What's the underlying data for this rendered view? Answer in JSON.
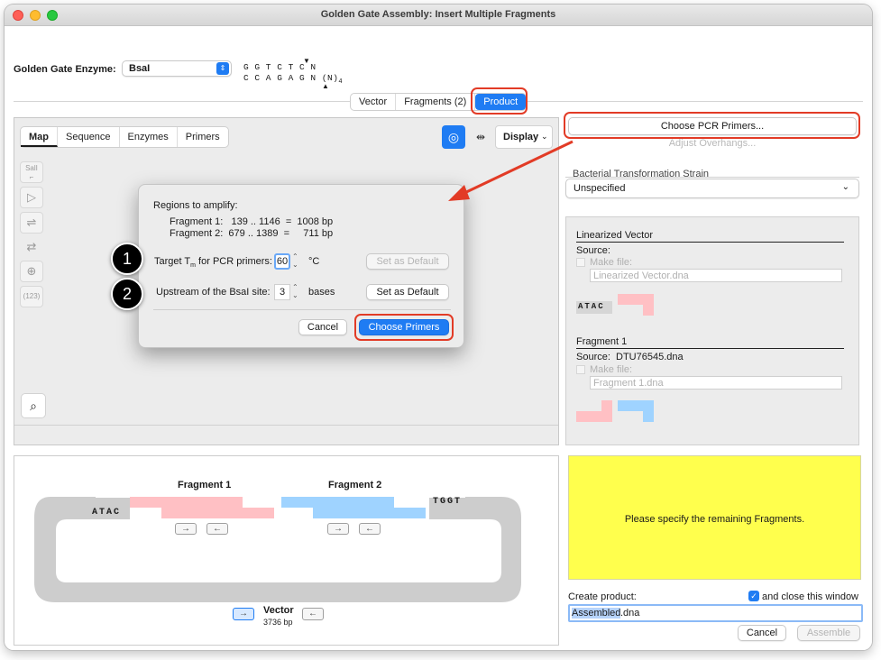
{
  "window": {
    "title": "Golden Gate Assembly: Insert Multiple Fragments"
  },
  "enzyme": {
    "label": "Golden Gate Enzyme:",
    "value": "BsaI",
    "site_top": "G G T C T C N",
    "site_bottom": "C C A G A G N (N)",
    "site_subscript": "4"
  },
  "top_tabs": [
    "Vector",
    "Fragments (2)",
    "Product"
  ],
  "view_tabs": [
    "Map",
    "Sequence",
    "Enzymes",
    "Primers"
  ],
  "display_label": "Display",
  "tool_icons": [
    "SalI",
    "(123)"
  ],
  "dialog": {
    "regions_title": "Regions to amplify:",
    "fragment1_row": "Fragment 1:   139 .. 1146  =  1008 bp",
    "fragment2_row": "Fragment 2:  679 .. 1389  =     711 bp",
    "tm_label": "Target T",
    "tm_sub": "m",
    "tm_label_rest": " for PCR primers:",
    "tm_value": "60",
    "tm_unit": "°C",
    "set_default_1": "Set as Default",
    "upstream_label": "Upstream of the BsaI site:",
    "upstream_value": "3",
    "upstream_unit": "bases",
    "set_default_2": "Set as Default",
    "cancel": "Cancel",
    "choose": "Choose Primers",
    "badge1": "1",
    "badge2": "2"
  },
  "right_panel": {
    "choose_pcr": "Choose PCR Primers...",
    "adjust_overhangs": "Adjust Overhangs...",
    "strain_label": "Bacterial Transformation Strain",
    "strain_value": "Unspecified",
    "linearized_title": "Linearized Vector",
    "source_label": "Source:",
    "make_file": "Make file:",
    "linearized_file": "Linearized Vector.dna",
    "overhang_1": "ATAC",
    "fragment1_title": "Fragment 1",
    "fragment1_source": "Source:  DTU76545.dna",
    "fragment1_make_file": "Make file:",
    "fragment1_file": "Fragment 1.dna"
  },
  "diagram": {
    "fragment1_label": "Fragment 1",
    "fragment2_label": "Fragment 2",
    "left_overhang": "ATAC",
    "right_overhang": "TGGT",
    "vector_label": "Vector",
    "vector_size": "3736 bp"
  },
  "status": {
    "message": "Please specify the remaining Fragments."
  },
  "create": {
    "label": "Create product:",
    "close_label": "and close this window",
    "filename_highlight": "Assembled",
    "filename_rest": ".dna",
    "cancel": "Cancel",
    "assemble": "Assemble"
  },
  "colors": {
    "accent": "#1f7cf3",
    "callout": "#e23b26",
    "pink": "#ffc0c4",
    "blue": "#9fd3ff",
    "yellow": "#ffff4d"
  }
}
